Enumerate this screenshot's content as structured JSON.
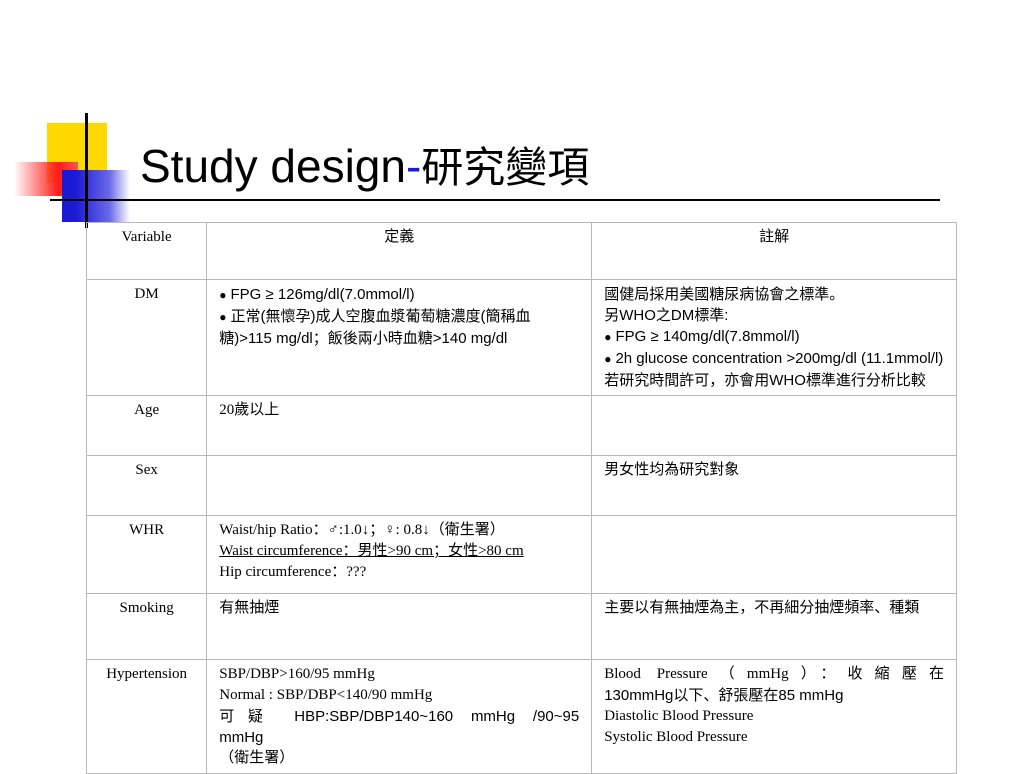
{
  "title": {
    "main": "Study design",
    "dash": "-",
    "cjk": "研究變項"
  },
  "header": {
    "variable": "Variable",
    "definition": "定義",
    "note": "註解"
  },
  "rows": {
    "dm": {
      "var": "DM",
      "def1": "FPG ≥ 126mg/dl(7.0mmol/l)",
      "def2": "正常(無懷孕)成人空腹血漿葡萄糖濃度(簡稱血糖)>115 mg/dl；飯後兩小時血糖>140 mg/dl",
      "note1": "國健局採用美國糖尿病協會之標準。",
      "note2": "另WHO之DM標準:",
      "note3": "FPG ≥ 140mg/dl(7.8mmol/l)",
      "note4": "2h glucose concentration >200mg/dl (11.1mmol/l)",
      "note5": "若研究時間許可，亦會用WHO標準進行分析比較"
    },
    "age": {
      "var": "Age",
      "def": "20歲以上",
      "note": ""
    },
    "sex": {
      "var": "Sex",
      "def": "",
      "note": "男女性均為研究對象"
    },
    "whr": {
      "var": "WHR",
      "def1": "Waist/hip Ratio：♂:1.0↓；♀: 0.8↓（衛生署）",
      "def2": "Waist circumference：男性>90 cm；女性>80 cm",
      "def3": "Hip circumference：???",
      "note": ""
    },
    "smoking": {
      "var": "Smoking",
      "def": "有無抽煙",
      "note": "主要以有無抽煙為主，不再細分抽煙頻率、種類"
    },
    "hypertension": {
      "var": "Hypertension",
      "def1": "SBP/DBP>160/95 mmHg",
      "def2": "Normal : SBP/DBP<140/90 mmHg",
      "def3": "可疑 HBP:SBP/DBP140~160 mmHg /90~95",
      "def3b": "mmHg",
      "def4": "（衛生署）",
      "note1": "Blood Pressure（mmHg）：收縮壓在",
      "note2": "130mmHg以下、舒張壓在85 mmHg",
      "note3": "Diastolic Blood Pressure",
      "note4": "Systolic Blood Pressure"
    }
  }
}
